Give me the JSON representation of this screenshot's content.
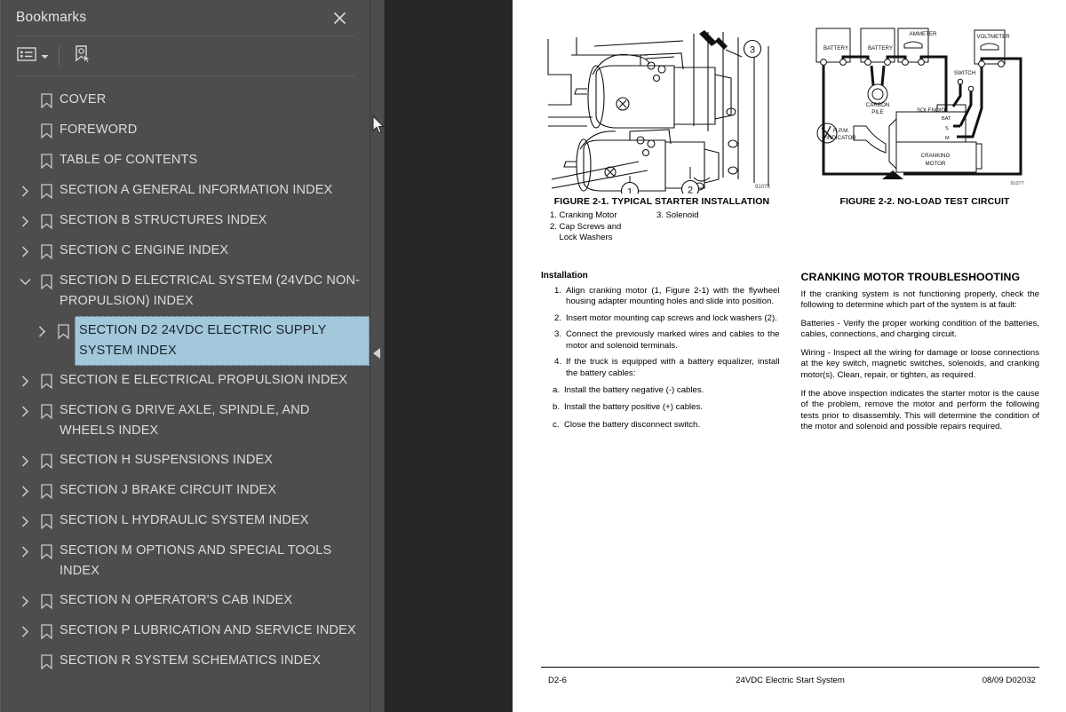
{
  "panel": {
    "title": "Bookmarks",
    "close_icon": "close-icon",
    "toolbar": {
      "options_icon": "list-options-icon",
      "options_caret_icon": "chevron-down-icon",
      "find_bookmark_icon": "bookmark-pointer-icon"
    },
    "collapse_arrow_icon": "collapse-left-arrow-icon"
  },
  "bookmarks": [
    {
      "label": "COVER",
      "level": 1,
      "expandable": false,
      "expanded": false,
      "selected": false
    },
    {
      "label": "FOREWORD",
      "level": 1,
      "expandable": false,
      "expanded": false,
      "selected": false
    },
    {
      "label": "TABLE OF CONTENTS",
      "level": 1,
      "expandable": false,
      "expanded": false,
      "selected": false
    },
    {
      "label": "SECTION A GENERAL INFORMATION INDEX",
      "level": 1,
      "expandable": true,
      "expanded": false,
      "selected": false
    },
    {
      "label": "SECTION B STRUCTURES INDEX",
      "level": 1,
      "expandable": true,
      "expanded": false,
      "selected": false
    },
    {
      "label": "SECTION C ENGINE INDEX",
      "level": 1,
      "expandable": true,
      "expanded": false,
      "selected": false
    },
    {
      "label": "SECTION D ELECTRICAL SYSTEM (24VDC NON-PROPULSION) INDEX",
      "level": 1,
      "expandable": true,
      "expanded": true,
      "selected": false
    },
    {
      "label": "SECTION D2 24VDC ELECTRIC SUPPLY SYSTEM INDEX",
      "level": 2,
      "expandable": true,
      "expanded": false,
      "selected": true
    },
    {
      "label": "SECTION E ELECTRICAL PROPULSION INDEX",
      "level": 1,
      "expandable": true,
      "expanded": false,
      "selected": false
    },
    {
      "label": "SECTION G DRIVE AXLE, SPINDLE, AND WHEELS INDEX",
      "level": 1,
      "expandable": true,
      "expanded": false,
      "selected": false
    },
    {
      "label": "SECTION H SUSPENSIONS INDEX",
      "level": 1,
      "expandable": true,
      "expanded": false,
      "selected": false
    },
    {
      "label": "SECTION J BRAKE CIRCUIT INDEX",
      "level": 1,
      "expandable": true,
      "expanded": false,
      "selected": false
    },
    {
      "label": "SECTION L HYDRAULIC SYSTEM INDEX",
      "level": 1,
      "expandable": true,
      "expanded": false,
      "selected": false
    },
    {
      "label": "SECTION M OPTIONS AND SPECIAL TOOLS INDEX",
      "level": 1,
      "expandable": true,
      "expanded": false,
      "selected": false
    },
    {
      "label": "SECTION N OPERATOR'S CAB INDEX",
      "level": 1,
      "expandable": true,
      "expanded": false,
      "selected": false
    },
    {
      "label": "SECTION P LUBRICATION AND SERVICE INDEX",
      "level": 1,
      "expandable": true,
      "expanded": false,
      "selected": false
    },
    {
      "label": "SECTION R SYSTEM SCHEMATICS INDEX",
      "level": 1,
      "expandable": false,
      "expanded": false,
      "selected": false
    }
  ],
  "document": {
    "figure1": {
      "caption": "FIGURE 2-1. TYPICAL STARTER INSTALLATION",
      "ref_code": "91075",
      "callouts": [
        "1",
        "2",
        "3"
      ],
      "legend_left": [
        "1. Cranking Motor",
        "2. Cap Screws and",
        "    Lock Washers"
      ],
      "legend_right": [
        "3. Solenoid"
      ]
    },
    "figure2": {
      "caption": "FIGURE 2-2. NO-LOAD TEST CIRCUIT",
      "ref_code": "91077",
      "labels": [
        "BATTERY",
        "BATTERY",
        "AMMETER",
        "VOLTMETER",
        "SWITCH",
        "CARBON PILE",
        "SOLENOID",
        "BAT",
        "S",
        "M",
        "R.P.M. INDICATOR",
        "CRANKING MOTOR"
      ]
    },
    "left_column": {
      "heading": "Installation",
      "steps": [
        {
          "num": "1.",
          "text": "Align cranking motor (1, Figure 2-1) with the flywheel housing adapter mounting holes and slide into position."
        },
        {
          "num": "2.",
          "text": "Insert motor mounting cap screws and lock washers (2)."
        },
        {
          "num": "3.",
          "text": "Connect the previously marked wires and cables to the motor and solenoid terminals."
        },
        {
          "num": "4.",
          "text": "If the truck is equipped with a battery equalizer, install the battery cables:"
        }
      ],
      "substeps": [
        {
          "num": "a.",
          "text": "Install the battery negative (-) cables."
        },
        {
          "num": "b.",
          "text": "Install the battery positive (+) cables."
        },
        {
          "num": "c.",
          "text": "Close the battery disconnect switch."
        }
      ]
    },
    "right_column": {
      "heading": "CRANKING MOTOR TROUBLESHOOTING",
      "paragraphs": [
        "If the cranking system is not functioning properly, check the following to determine which part of the system is at fault:",
        "Batteries - Verify the proper working condition of the batteries, cables, connections, and charging circuit.",
        "Wiring - Inspect all the wiring for damage or loose connections at the key switch, magnetic switches, solenoids, and cranking motor(s). Clean, repair, or tighten, as required.",
        "If the above inspection indicates the starter motor is the cause of the problem, remove the motor and perform the following tests prior to disassembly. This will determine the condition of the motor and solenoid and possible repairs required."
      ]
    },
    "footer": {
      "page_number": "D2-6",
      "title": "24VDC Electric Start System",
      "doc_code": "08/09  D02032"
    }
  },
  "colors": {
    "panel_bg": "#4d4d4d",
    "viewer_bg": "#262626",
    "selection": "#a3c7db",
    "text": "#dcdcdc"
  }
}
